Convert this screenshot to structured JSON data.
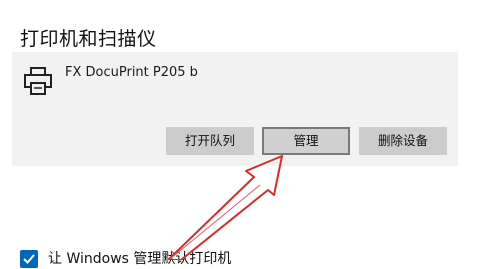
{
  "section": {
    "title": "打印机和扫描仪"
  },
  "printer": {
    "name": "FX DocuPrint P205 b",
    "icon": "printer-icon",
    "buttons": {
      "open_queue": "打开队列",
      "manage": "管理",
      "remove": "删除设备"
    }
  },
  "setting": {
    "checkbox_label": "让 Windows 管理默认打印机",
    "checked": true,
    "checkbox_icon": "checkmark-icon",
    "accent_color": "#0067c0"
  },
  "annotation": {
    "arrow_color": "#d32f2f",
    "arrow_icon": "red-arrow-icon"
  }
}
